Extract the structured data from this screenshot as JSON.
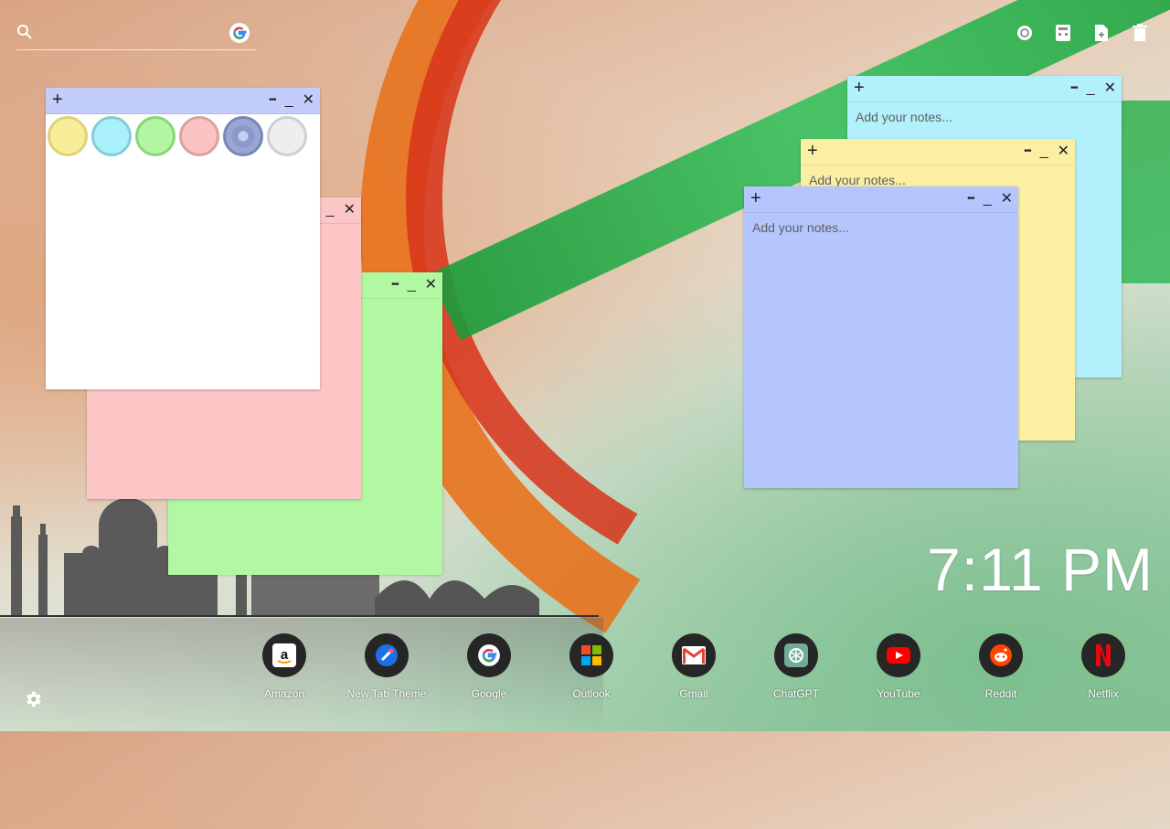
{
  "search": {
    "placeholder": ""
  },
  "top_icons": [
    "screenshot-icon",
    "calculator-icon",
    "new-note-icon",
    "trash-icon"
  ],
  "notes": {
    "picker": {
      "color": "#ffffff",
      "swatches": [
        "#f8ee9a",
        "#a9f0fa",
        "#b2f5a3",
        "#fcc3c5",
        "#9aa7d6",
        "#eeeeee"
      ]
    },
    "pink": {
      "color": "#fcc5c6"
    },
    "green": {
      "color": "#b2f7a1"
    },
    "cyan": {
      "color": "#b2f0fb",
      "placeholder": "Add your notes..."
    },
    "yellow": {
      "color": "#fbefa3",
      "placeholder": "Add your notes..."
    },
    "blue": {
      "color": "#b4c6fd",
      "placeholder": "Add your notes..."
    },
    "controls": {
      "add": "+",
      "more": "•••",
      "minimize": "_",
      "close": "✕"
    }
  },
  "clock": {
    "time": "7:11 PM"
  },
  "dock": {
    "apps": [
      {
        "label": "Amazon",
        "icon": "amazon-icon"
      },
      {
        "label": "New Tab Theme",
        "icon": "new-tab-theme-icon"
      },
      {
        "label": "Google",
        "icon": "google-icon"
      },
      {
        "label": "Outlook",
        "icon": "outlook-icon"
      },
      {
        "label": "Gmail",
        "icon": "gmail-icon"
      },
      {
        "label": "ChatGPT",
        "icon": "chatgpt-icon"
      },
      {
        "label": "YouTube",
        "icon": "youtube-icon"
      },
      {
        "label": "Reddit",
        "icon": "reddit-icon"
      },
      {
        "label": "Netflix",
        "icon": "netflix-icon"
      }
    ]
  }
}
